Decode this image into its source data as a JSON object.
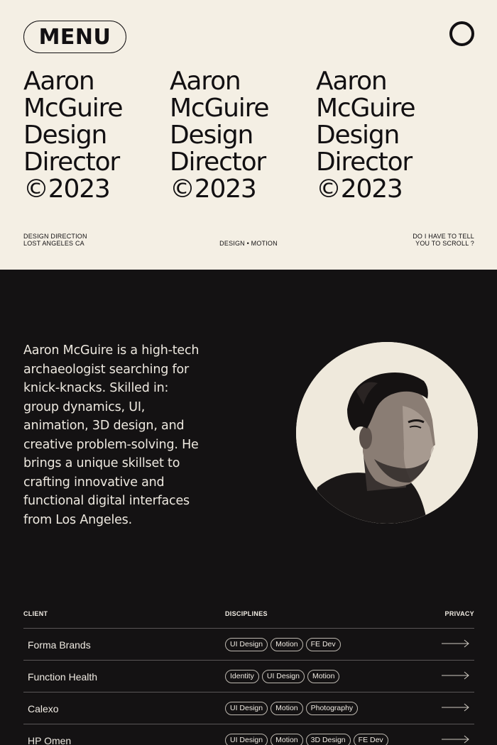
{
  "header": {
    "menu_label": "MENU",
    "title_lines": [
      "Aaron",
      "McGuire",
      "Design",
      "Director",
      "©2023"
    ],
    "location_lines": [
      "DESIGN DIRECTION",
      "LOST ANGELES CA"
    ],
    "center_text": "DESIGN • MOTION",
    "scroll_lines": [
      "DO I  HAVE TO TELL",
      "YOU TO SCROLL ?"
    ]
  },
  "about": {
    "bio_lines": [
      "Aaron McGuire is a high-tech",
      "archaeologist searching for",
      "knick-knacks. Skilled in:",
      "group dynamics, UI,",
      "animation, 3D design, and",
      "creative problem-solving. He",
      "brings a unique skillset to",
      "crafting innovative and",
      "functional digital interfaces",
      "from Los Angeles."
    ]
  },
  "table": {
    "headers": {
      "client": "CLIENT",
      "disciplines": "DISCIPLINES",
      "privacy": "PRIVACY"
    },
    "rows": [
      {
        "client": "Forma Brands",
        "tags": [
          "UI Design",
          "Motion",
          "FE Dev"
        ]
      },
      {
        "client": "Function Health",
        "tags": [
          "Identity",
          "UI Design",
          "Motion"
        ]
      },
      {
        "client": "Calexo",
        "tags": [
          "UI Design",
          "Motion",
          "Photography"
        ]
      },
      {
        "client": "HP Omen",
        "tags": [
          "UI Design",
          "Motion",
          "3D Design",
          "FE Dev"
        ]
      }
    ]
  },
  "colors": {
    "cream": "#f4efe4",
    "dark": "#141213",
    "ink": "#121012"
  }
}
